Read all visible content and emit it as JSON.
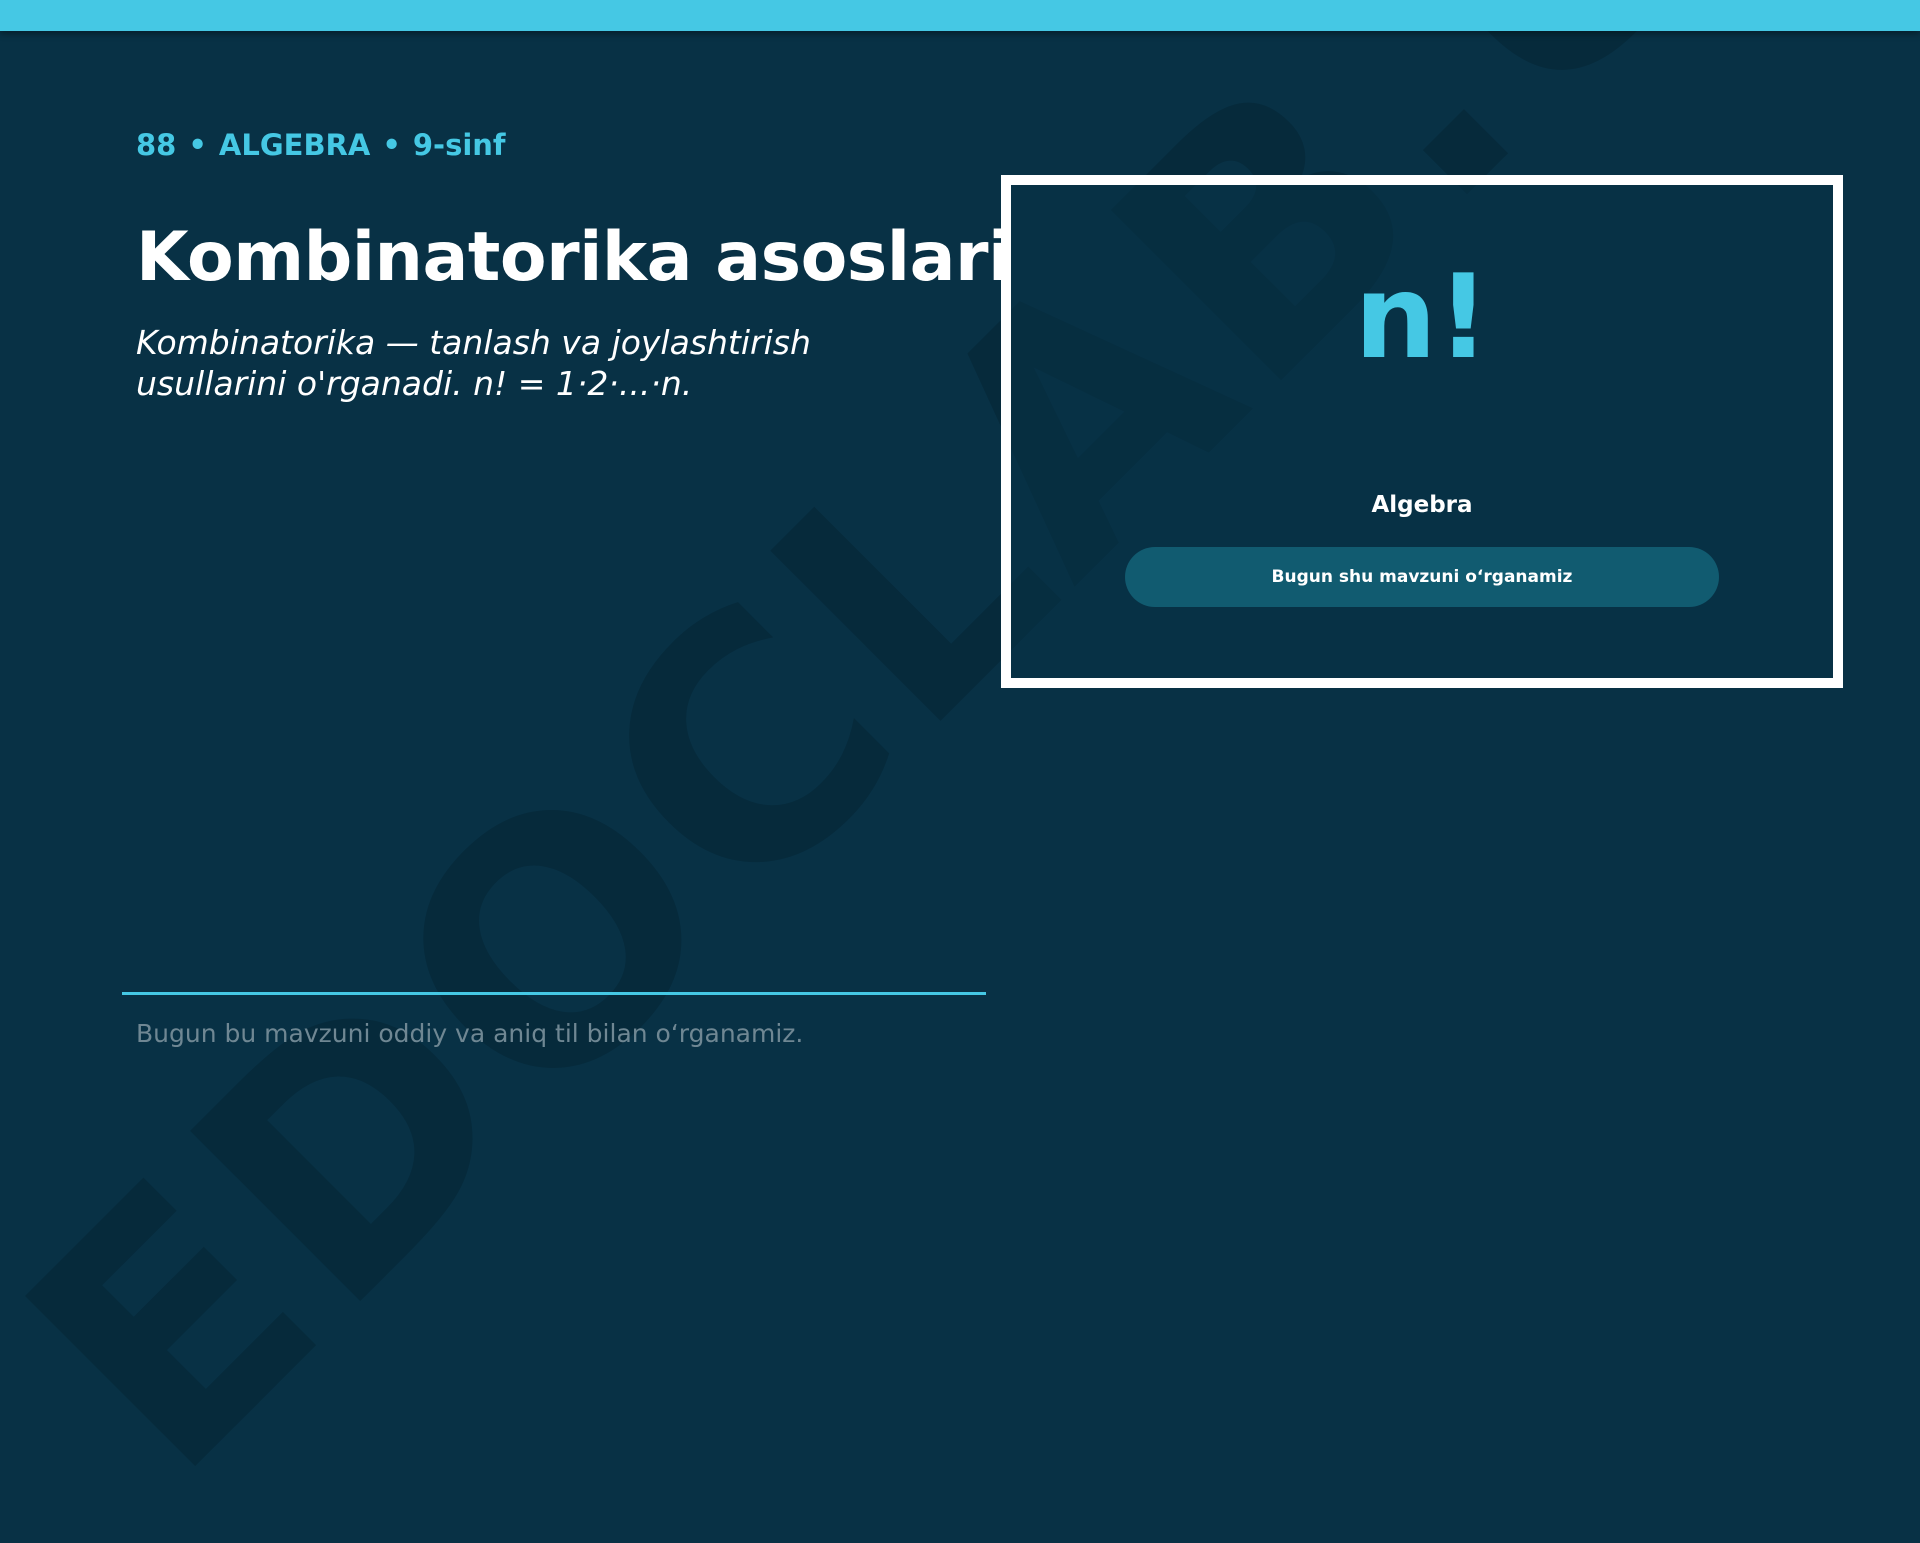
{
  "watermark": {
    "text": "EDOCLAB.UZ"
  },
  "kicker": {
    "number": "88",
    "separator": "•",
    "subject": "ALGEBRA",
    "grade": "9-sinf"
  },
  "title": "Kombinatorika asoslari",
  "subtitle": "Kombinatorika — tanlash va joylashtirish usullarini o'rganadi. n! = 1·2·...·n.",
  "card": {
    "symbol": "n!",
    "label": "Algebra",
    "button_label": "Bugun shu mavzuni o‘rganamiz"
  },
  "footer": {
    "text": "Bugun bu mavzuni oddiy va aniq til bilan o‘rganamiz."
  },
  "colors": {
    "background": "#083145",
    "accent": "#45c8e4",
    "button": "#115b70",
    "text": "#ffffff",
    "muted": "#6f8793"
  }
}
